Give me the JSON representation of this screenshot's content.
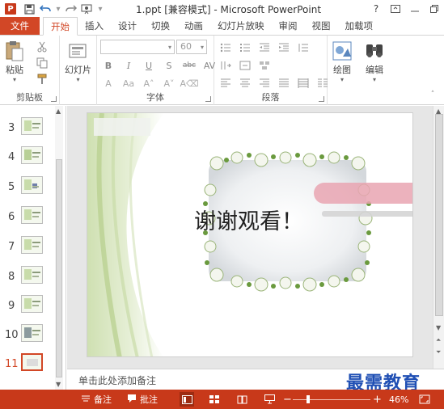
{
  "window": {
    "title": "1.ppt [兼容模式] - Microsoft PowerPoint",
    "app_icon_label": "P",
    "help_label": "?",
    "accent_color": "#d24726"
  },
  "tabs": [
    {
      "label": "文件"
    },
    {
      "label": "开始"
    },
    {
      "label": "插入"
    },
    {
      "label": "设计"
    },
    {
      "label": "切换"
    },
    {
      "label": "动画"
    },
    {
      "label": "幻灯片放映"
    },
    {
      "label": "审阅"
    },
    {
      "label": "视图"
    },
    {
      "label": "加载项"
    }
  ],
  "ribbon": {
    "clipboard": {
      "label": "剪贴板",
      "paste_label": "粘贴"
    },
    "slides": {
      "new_slide_label": "幻灯片"
    },
    "font": {
      "label": "字体",
      "size_value": "60"
    },
    "paragraph": {
      "label": "段落"
    },
    "drawing": {
      "label": "绘图"
    },
    "editing": {
      "label": "编辑"
    }
  },
  "thumbnails": [
    {
      "number": "3"
    },
    {
      "number": "4"
    },
    {
      "number": "5"
    },
    {
      "number": "6"
    },
    {
      "number": "7"
    },
    {
      "number": "8"
    },
    {
      "number": "9"
    },
    {
      "number": "10"
    },
    {
      "number": "11",
      "active": true
    }
  ],
  "slide": {
    "text": "谢谢观看！"
  },
  "notes": {
    "placeholder": "单击此处添加备注"
  },
  "watermark": "最需教育",
  "statusbar": {
    "notes_label": "备注",
    "comments_label": "批注",
    "zoom_label": "46%",
    "zoom_value": 46
  }
}
